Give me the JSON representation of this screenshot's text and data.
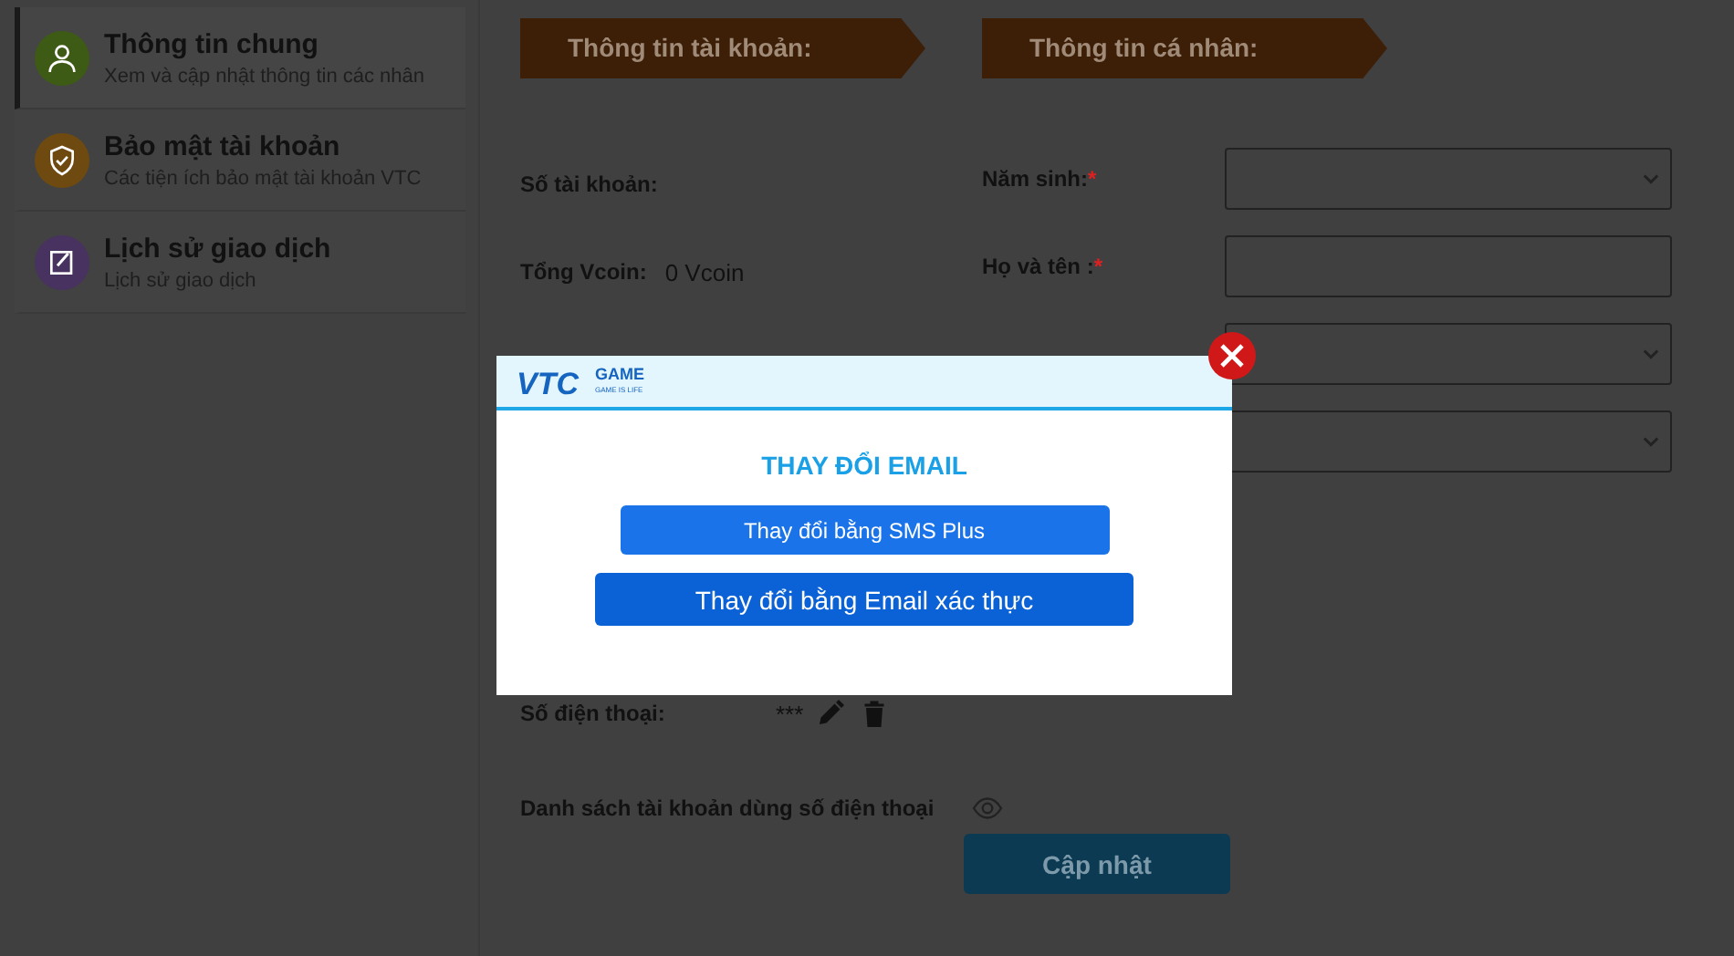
{
  "sidebar": {
    "items": [
      {
        "title": "Thông tin chung",
        "subtitle": "Xem và cập nhật thông tin các nhân",
        "selected": true,
        "color": "#3e5b16",
        "kind": "user"
      },
      {
        "title": "Bảo mật tài khoản",
        "subtitle": "Các tiện ích bảo mật tài khoản VTC",
        "selected": false,
        "color": "#6e4a10",
        "kind": "shield"
      },
      {
        "title": "Lịch sử giao dịch",
        "subtitle": "Lịch sử giao dịch",
        "selected": false,
        "color": "#48325f",
        "kind": "note"
      }
    ]
  },
  "account": {
    "header": "Thông tin tài khoản:",
    "rows": [
      {
        "label": "Số tài khoản:"
      },
      {
        "label": "Tổng Vcoin:",
        "value": "0 Vcoin"
      }
    ],
    "phone": {
      "label": "Số điện thoại:",
      "value": "***"
    },
    "linked": {
      "label": "Danh sách tài khoản dùng số điện thoại"
    }
  },
  "personal": {
    "header": "Thông tin cá nhân:",
    "fields": [
      {
        "label": "Năm sinh:",
        "marker": "*",
        "kind": "select"
      },
      {
        "label": "Họ và tên :",
        "marker": "*",
        "kind": "text"
      },
      {
        "kind": "select"
      },
      {
        "kind": "select"
      }
    ],
    "submit": {
      "label": "Cập nhật",
      "disabled": true
    }
  },
  "modal": {
    "logo": {
      "mark": "VTC",
      "word": "GAME",
      "tagline": "GAME IS LIFE"
    },
    "title": "THAY ĐỔI EMAIL",
    "buttons": [
      {
        "label": "Thay đổi bằng SMS Plus"
      },
      {
        "label": "Thay đổi bằng Email xác thực"
      }
    ]
  }
}
